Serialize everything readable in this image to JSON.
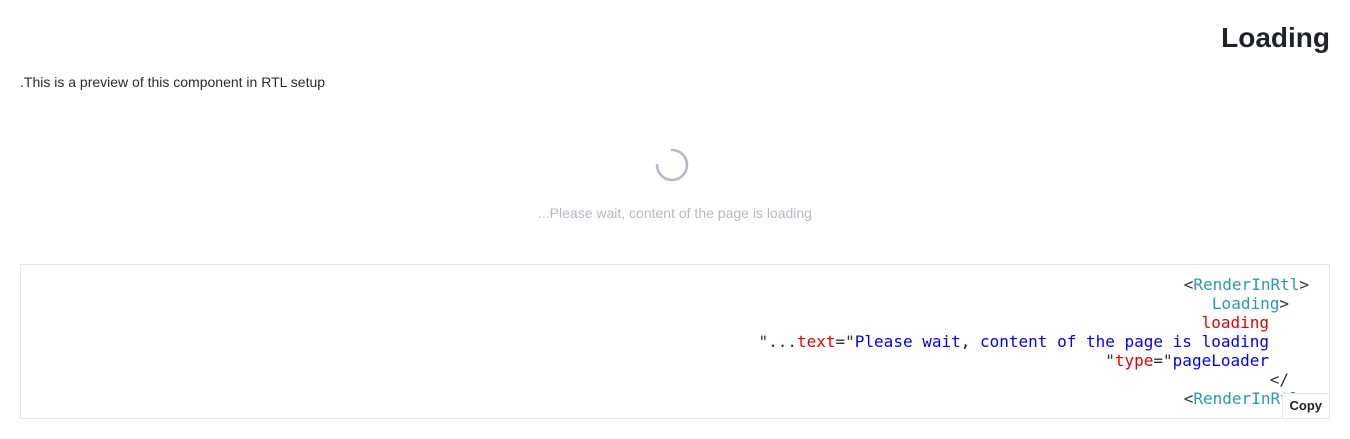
{
  "header": {
    "title": "Loading"
  },
  "description": ".This is a preview of this component in RTL setup",
  "preview": {
    "loading_text": "...Please wait, content of the page is loading",
    "spinner_icon": "spinner-icon",
    "spinner_color": "#b4bac4"
  },
  "code": {
    "lines": [
      {
        "p1": "<",
        "tag": "RenderInRtl",
        "p2": ">"
      },
      {
        "tag": "Loading",
        "p": ">"
      },
      {
        "attr": "loading"
      },
      {
        "q1": "\"...",
        "attr": "text",
        "eq": "=\"",
        "str": "Please wait, content of the page is loading"
      },
      {
        "q1": "\"",
        "attr": "type",
        "eq": "=\"",
        "str": "pageLoader"
      },
      {
        "p": "</"
      },
      {
        "p1": "<",
        "tag": "RenderInRtl",
        "p2": ">"
      }
    ],
    "copy_label": "Copy"
  }
}
